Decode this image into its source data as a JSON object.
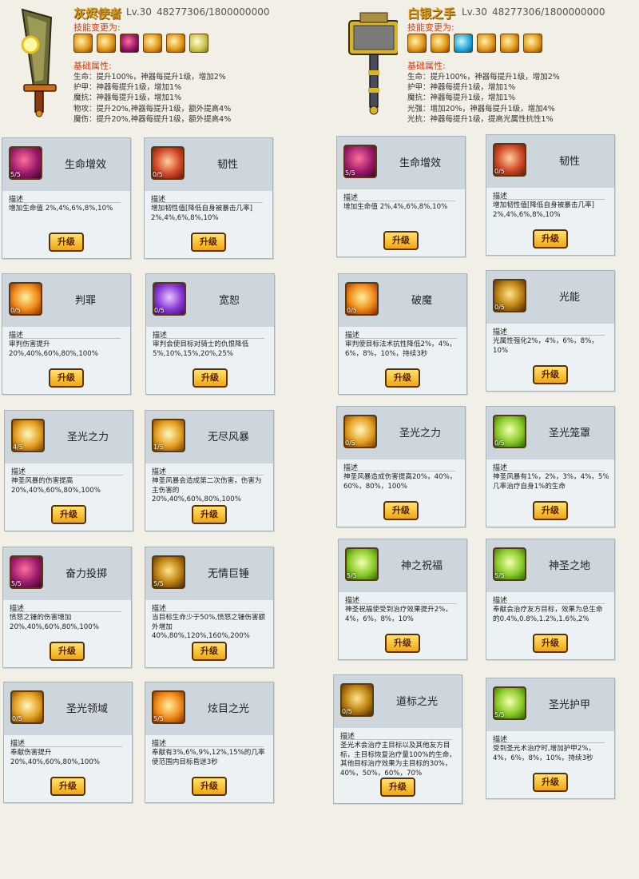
{
  "left_weapon": {
    "title": "灰烬使者",
    "level": "Lv.30",
    "exp": "48277306/1800000000",
    "skill_change_label": "技能变更为:",
    "skill_icons": [
      "gold",
      "gold",
      "red",
      "gold",
      "gold",
      "green"
    ],
    "base_attr_label": "基础属性:",
    "attributes": [
      "生命：提升100%，神器每提升1级，增加2%",
      "护甲：神器每提升1级，增加1%",
      "魔抗：神器每提升1级，增加1%",
      "物攻：提升20%,神器每提升1级，额外提高4%",
      "魔伤：提升20%,神器每提升1级，额外提高4%"
    ]
  },
  "right_weapon": {
    "title": "白银之手",
    "level": "Lv.30",
    "exp": "48277306/1800000000",
    "skill_change_label": "技能变更为:",
    "skill_icons": [
      "gold",
      "gold",
      "blue",
      "gold",
      "gold",
      "gold"
    ],
    "base_attr_label": "基础属性:",
    "attributes": [
      "生命：提升100%，神器每提升1级，增加2%",
      "护甲：神器每提升1级，增加1%",
      "魔抗：神器每提升1级，增加1%",
      "光强：增加20%，神器每提升1级，增加4%",
      "光抗：神器每提升1级，提高光属性抗性1%"
    ]
  },
  "desc_label": "描述",
  "upgrade_label": "升级",
  "cards": [
    {
      "name": "生命增效",
      "level": "5/5",
      "icon": "red",
      "desc": "增加生命值 2%,4%,6%,8%,10%"
    },
    {
      "name": "韧性",
      "level": "0/5",
      "icon": "shield",
      "desc": "增加韧性值[降低自身被暴击几率] 2%,4%,6%,8%,10%"
    },
    {
      "name": "判罪",
      "level": "0/5",
      "icon": "orange",
      "desc": "审判伤害提升20%,40%,60%,80%,100%"
    },
    {
      "name": "宽恕",
      "level": "0/5",
      "icon": "purple",
      "desc": "审判会使目标对骑士的仇恨降低5%,10%,15%,20%,25%"
    },
    {
      "name": "圣光之力",
      "level": "4/5",
      "icon": "gold",
      "desc": "神圣风暴的伤害提高20%,40%,60%,80%,100%"
    },
    {
      "name": "无尽风暴",
      "level": "1/5",
      "icon": "gold",
      "desc": "神圣风暴会造成第二次伤害，伤害为主伤害的20%,40%,60%,80%,100%"
    },
    {
      "name": "奋力投掷",
      "level": "5/5",
      "icon": "red",
      "desc": "愤怒之锤的伤害增加20%,40%,60%,80%,100%"
    },
    {
      "name": "无情巨锤",
      "level": "5/5",
      "icon": "dark",
      "desc": "当目标生命少于50%,愤怒之锤伤害额外增加40%,80%,120%,160%,200%"
    },
    {
      "name": "圣光领域",
      "level": "0/5",
      "icon": "gold",
      "desc": "奉献伤害提升20%,40%,60%,80%,100%"
    },
    {
      "name": "炫目之光",
      "level": "5/5",
      "icon": "orange",
      "desc": "奉献有3%,6%,9%,12%,15%的几率使范围内目标昏迷3秒"
    },
    {
      "name": "生命增效",
      "level": "5/5",
      "icon": "red",
      "desc": "增加生命值 2%,4%,6%,8%,10%"
    },
    {
      "name": "韧性",
      "level": "0/5",
      "icon": "shield",
      "desc": "增加韧性值[降低自身被暴击几率] 2%,4%,6%,8%,10%"
    },
    {
      "name": "破魔",
      "level": "0/5",
      "icon": "orange",
      "desc": "审判使目标法术抗性降低2%，4%，6%，8%，10%，持续3秒"
    },
    {
      "name": "光能",
      "level": "0/5",
      "icon": "dark",
      "desc": "光属性强化2%，4%，6%，8%，10%"
    },
    {
      "name": "圣光之力",
      "level": "0/5",
      "icon": "gold",
      "desc": "神圣风暴造成伤害提高20%，40%，60%，80%，100%"
    },
    {
      "name": "圣光笼罩",
      "level": "0/5",
      "icon": "green",
      "desc": "神圣风暴有1%，2%，3%，4%，5%几率治疗自身1%的生命"
    },
    {
      "name": "神之祝福",
      "level": "5/5",
      "icon": "green",
      "desc": "神圣祝福使受到治疗效果提升2%，4%，6%，8%，10%"
    },
    {
      "name": "神圣之地",
      "level": "5/5",
      "icon": "green",
      "desc": "奉献会治疗友方目标，效果为总生命的0.4%,0.8%,1.2%,1.6%,2%"
    },
    {
      "name": "道标之光",
      "level": "0/5",
      "icon": "dark",
      "desc": "圣光术会治疗主目标以及其他友方目标，主目标恢复治疗量100%的生命，其他目标治疗效果为主目标的30%，40%，50%，60%，70%"
    },
    {
      "name": "圣光护甲",
      "level": "5/5",
      "icon": "green",
      "desc": "受到圣光术治疗时,增加护甲2%，4%，6%，8%，10%，持续3秒"
    }
  ]
}
